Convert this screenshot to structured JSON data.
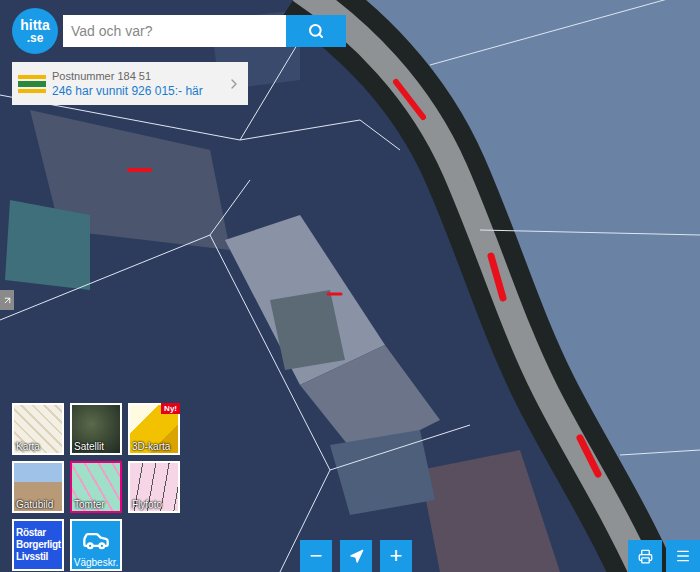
{
  "logo": {
    "name": "hitta",
    "tld": ".se"
  },
  "search": {
    "placeholder": "Vad och var?"
  },
  "postcode_card": {
    "title": "Postnummer 184 51",
    "text": "246 har vunnit 926 015:- här"
  },
  "tiles": [
    {
      "kind": "map",
      "label": "Karta",
      "selected": false
    },
    {
      "kind": "satellite",
      "label": "Satellit",
      "selected": false
    },
    {
      "kind": "threed",
      "label": "3D-karta",
      "badge": "Ny!",
      "selected": false
    },
    {
      "kind": "street",
      "label": "Gatubild",
      "selected": false
    },
    {
      "kind": "plots",
      "label": "Tomter",
      "selected": true
    },
    {
      "kind": "aerial",
      "label": "Flyfoto",
      "selected": false
    },
    {
      "kind": "info",
      "lines": [
        "Röstar",
        "Borgerligt",
        "Livsstil"
      ],
      "selected": false
    },
    {
      "kind": "route",
      "label": "Vägbeskr.",
      "selected": false
    }
  ],
  "zoom": {
    "out": "−",
    "in": "+"
  }
}
